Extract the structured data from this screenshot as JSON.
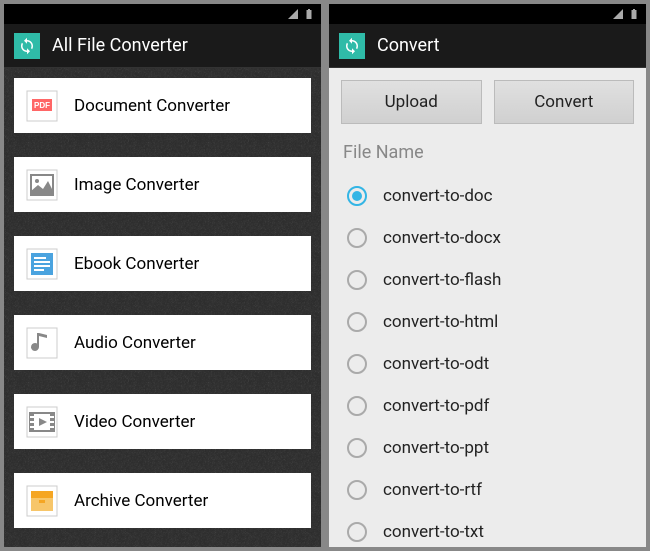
{
  "left": {
    "title": "All File Converter",
    "items": [
      {
        "label": "Document Converter",
        "icon": "pdf"
      },
      {
        "label": "Image Converter",
        "icon": "image"
      },
      {
        "label": "Ebook Converter",
        "icon": "ebook"
      },
      {
        "label": "Audio Converter",
        "icon": "audio"
      },
      {
        "label": "Video Converter",
        "icon": "video"
      },
      {
        "label": "Archive Converter",
        "icon": "archive"
      }
    ]
  },
  "right": {
    "title": "Convert",
    "upload_label": "Upload",
    "convert_label": "Convert",
    "section_label": "File Name",
    "options": [
      {
        "label": "convert-to-doc",
        "checked": true
      },
      {
        "label": "convert-to-docx",
        "checked": false
      },
      {
        "label": "convert-to-flash",
        "checked": false
      },
      {
        "label": "convert-to-html",
        "checked": false
      },
      {
        "label": "convert-to-odt",
        "checked": false
      },
      {
        "label": "convert-to-pdf",
        "checked": false
      },
      {
        "label": "convert-to-ppt",
        "checked": false
      },
      {
        "label": "convert-to-rtf",
        "checked": false
      },
      {
        "label": "convert-to-txt",
        "checked": false
      }
    ]
  }
}
